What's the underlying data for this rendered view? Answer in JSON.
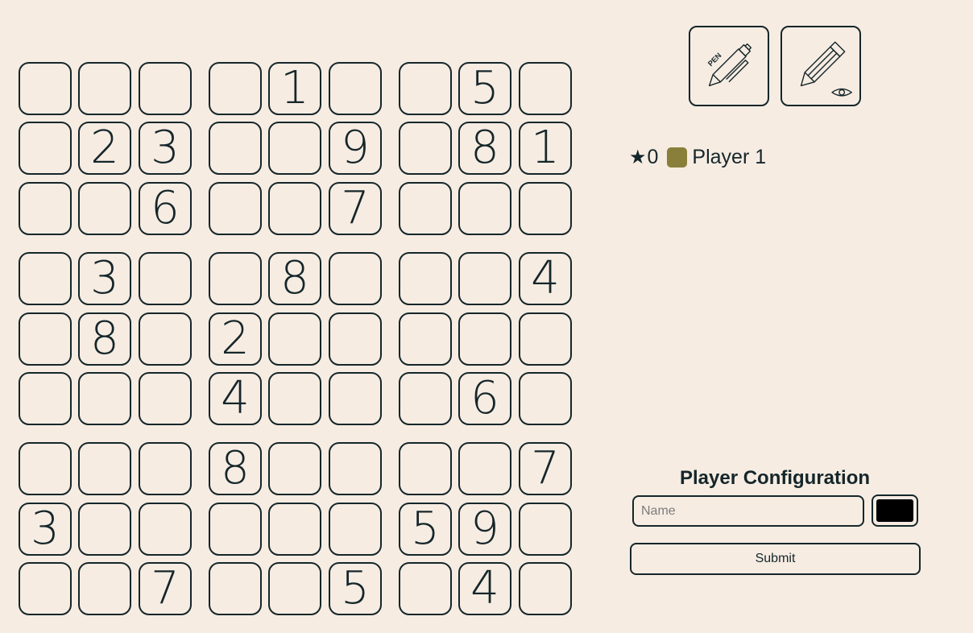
{
  "board": {
    "rows": [
      [
        "",
        "",
        "",
        "",
        "1",
        "",
        "",
        "5",
        ""
      ],
      [
        "",
        "2",
        "3",
        "",
        "",
        "9",
        "",
        "8",
        "1"
      ],
      [
        "",
        "",
        "6",
        "",
        "",
        "7",
        "",
        "",
        ""
      ],
      [
        "",
        "3",
        "",
        "",
        "8",
        "",
        "",
        "",
        "4"
      ],
      [
        "",
        "8",
        "",
        "2",
        "",
        "",
        "",
        "",
        ""
      ],
      [
        "",
        "",
        "",
        "4",
        "",
        "",
        "",
        "6",
        ""
      ],
      [
        "",
        "",
        "",
        "8",
        "",
        "",
        "",
        "",
        "7"
      ],
      [
        "3",
        "",
        "",
        "",
        "",
        "",
        "5",
        "9",
        ""
      ],
      [
        "",
        "",
        "7",
        "",
        "",
        "5",
        "",
        "4",
        ""
      ]
    ]
  },
  "tools": {
    "pen": {
      "icon": "pen-icon",
      "label": "PEN"
    },
    "pencil": {
      "icon": "pencil-eye-icon"
    }
  },
  "players": [
    {
      "icon": "star-icon",
      "star": "★",
      "score": "0",
      "color": "#8a7f3a",
      "name": "Player 1"
    }
  ],
  "config": {
    "title": "Player Configuration",
    "name_placeholder": "Name",
    "name_value": "",
    "color_value": "#000000",
    "submit_label": "Submit"
  },
  "colors": {
    "background": "#f6ece2",
    "ink": "#15262a"
  }
}
